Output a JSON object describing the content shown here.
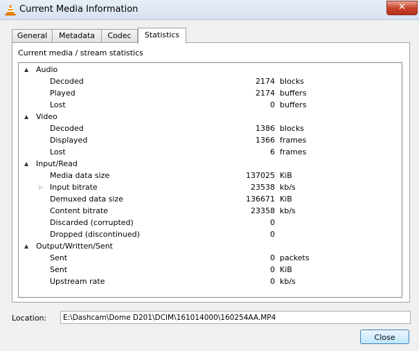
{
  "window": {
    "title": "Current Media Information",
    "close_glyph": "✕"
  },
  "tabs": [
    {
      "label": "General"
    },
    {
      "label": "Metadata"
    },
    {
      "label": "Codec"
    },
    {
      "label": "Statistics",
      "active": true
    }
  ],
  "panel": {
    "title": "Current media / stream statistics"
  },
  "tree": {
    "audio": {
      "label": "Audio",
      "decoded": {
        "label": "Decoded",
        "value": "2174",
        "unit": "blocks"
      },
      "played": {
        "label": "Played",
        "value": "2174",
        "unit": "buffers"
      },
      "lost": {
        "label": "Lost",
        "value": "0",
        "unit": "buffers"
      }
    },
    "video": {
      "label": "Video",
      "decoded": {
        "label": "Decoded",
        "value": "1386",
        "unit": "blocks"
      },
      "displayed": {
        "label": "Displayed",
        "value": "1366",
        "unit": "frames"
      },
      "lost": {
        "label": "Lost",
        "value": "6",
        "unit": "frames"
      }
    },
    "input": {
      "label": "Input/Read",
      "media_size": {
        "label": "Media data size",
        "value": "137025",
        "unit": "KiB"
      },
      "input_bitrate": {
        "label": "Input bitrate",
        "value": "23538",
        "unit": "kb/s"
      },
      "demuxed_size": {
        "label": "Demuxed data size",
        "value": "136671",
        "unit": "KiB"
      },
      "content_bitrate": {
        "label": "Content bitrate",
        "value": "23358",
        "unit": "kb/s"
      },
      "discarded": {
        "label": "Discarded (corrupted)",
        "value": "0",
        "unit": ""
      },
      "dropped": {
        "label": "Dropped (discontinued)",
        "value": "0",
        "unit": ""
      }
    },
    "output": {
      "label": "Output/Written/Sent",
      "sent_packets": {
        "label": "Sent",
        "value": "0",
        "unit": "packets"
      },
      "sent_kib": {
        "label": "Sent",
        "value": "0",
        "unit": "KiB"
      },
      "upstream": {
        "label": "Upstream rate",
        "value": "0",
        "unit": "kb/s"
      }
    }
  },
  "location": {
    "label": "Location:",
    "value": "E:\\Dashcam\\Dome D201\\DCIM\\161014000\\160254AA.MP4"
  },
  "buttons": {
    "close": "Close"
  },
  "icons": {
    "app": "vlc-cone-icon",
    "expanded": "▲",
    "collapsed": "▷"
  }
}
